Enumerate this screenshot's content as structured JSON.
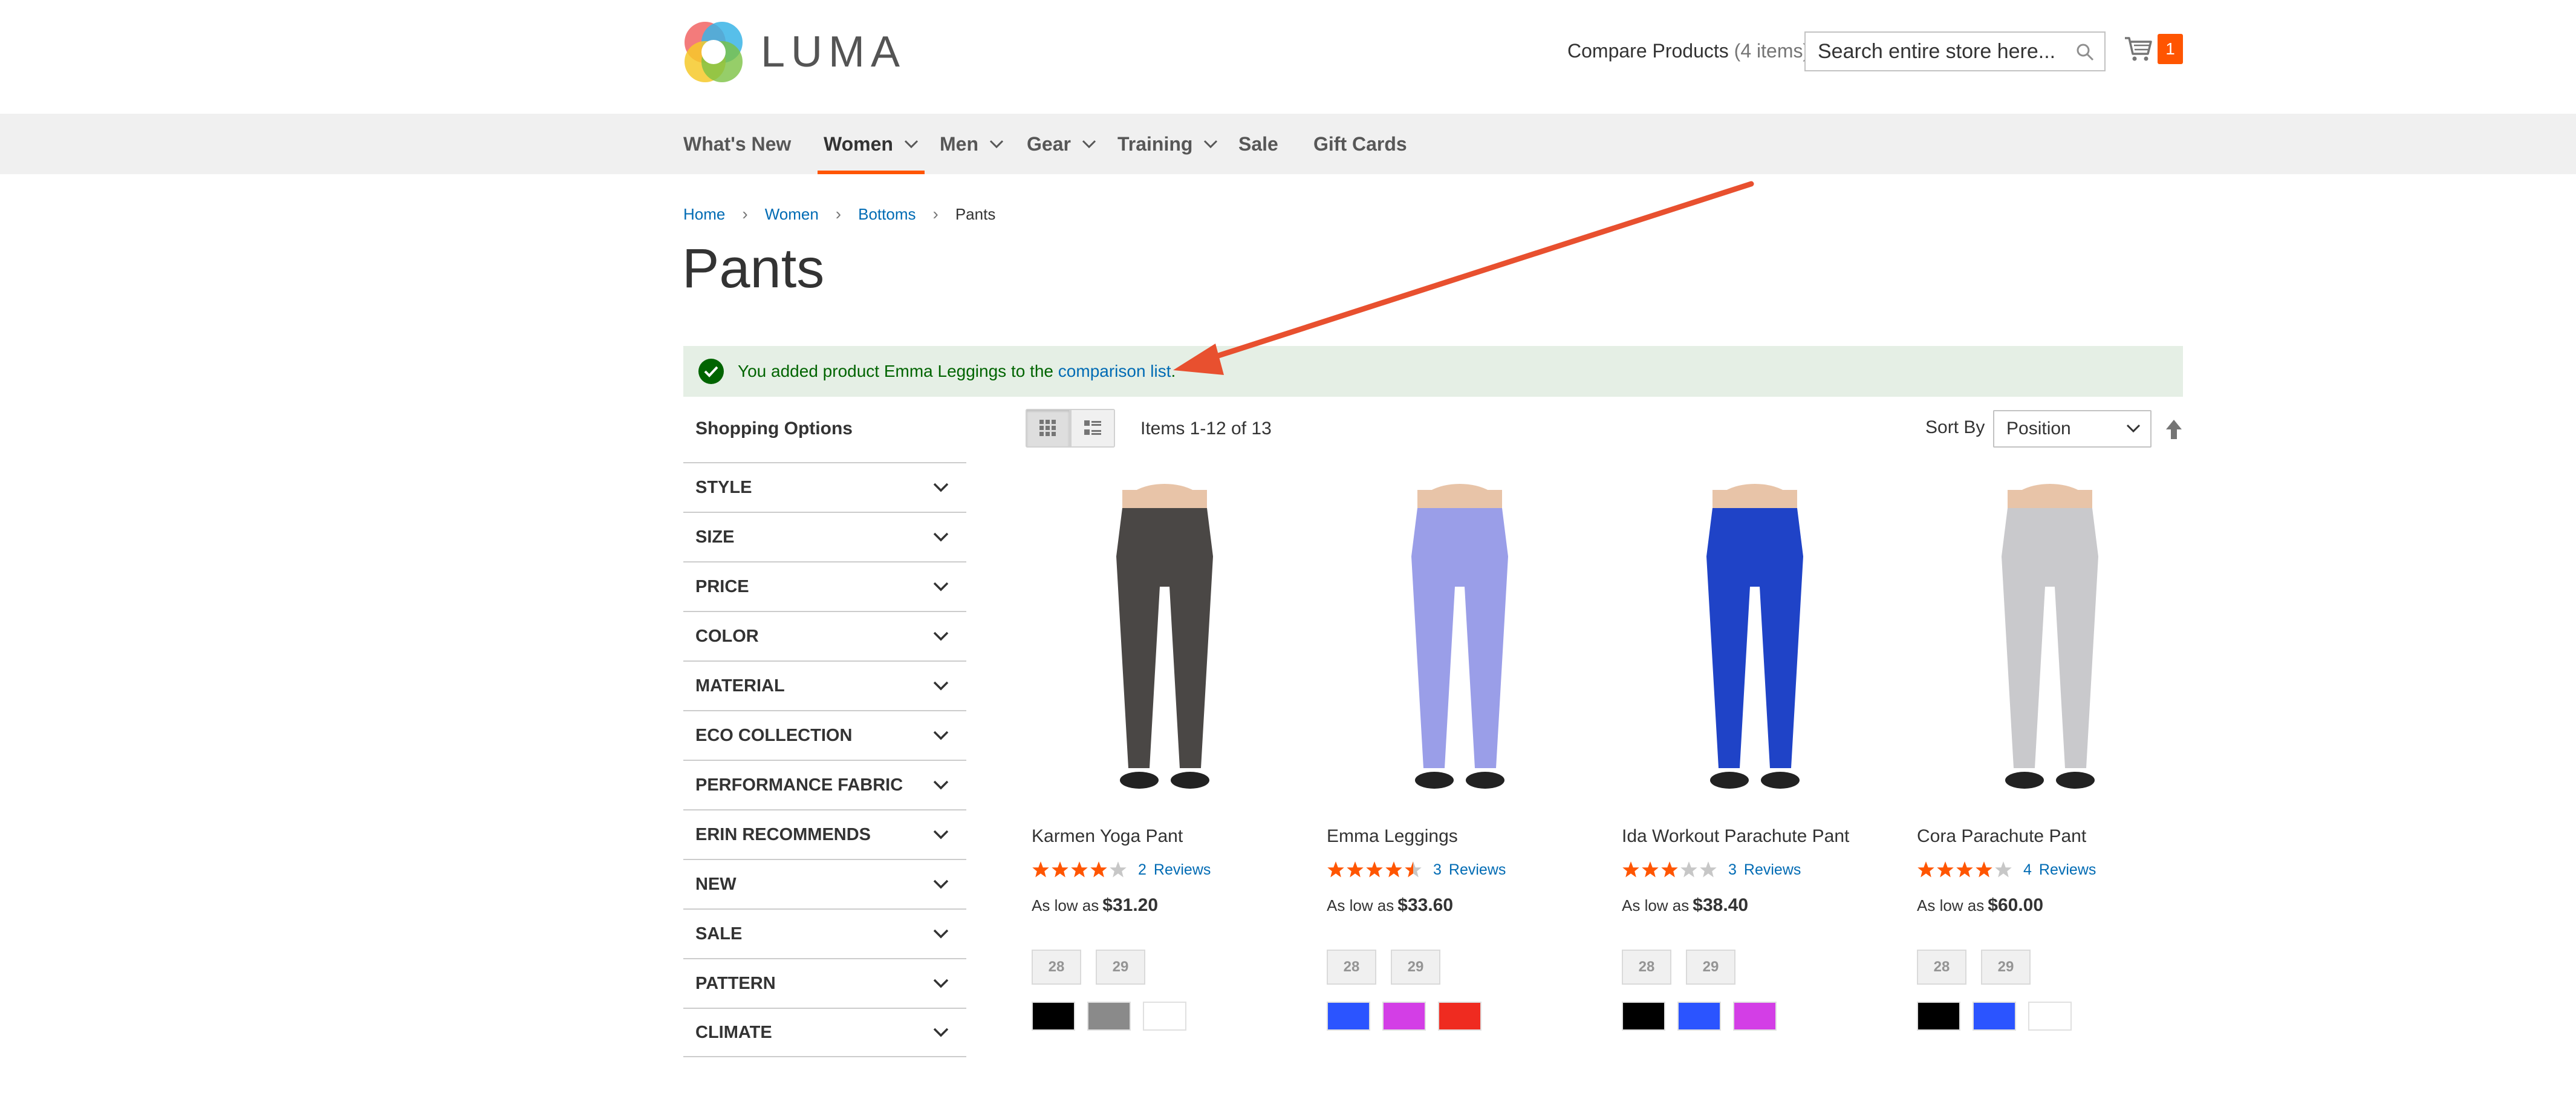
{
  "header": {
    "logo_text": "LUMA",
    "compare": {
      "label": "Compare Products",
      "count": "(4 items)"
    },
    "search": {
      "placeholder": "Search entire store here..."
    },
    "cart_count": "1"
  },
  "nav": [
    {
      "label": "What's New",
      "has_dropdown": false
    },
    {
      "label": "Women",
      "has_dropdown": true,
      "active": true
    },
    {
      "label": "Men",
      "has_dropdown": true
    },
    {
      "label": "Gear",
      "has_dropdown": true
    },
    {
      "label": "Training",
      "has_dropdown": true
    },
    {
      "label": "Sale",
      "has_dropdown": false
    },
    {
      "label": "Gift Cards",
      "has_dropdown": false
    }
  ],
  "breadcrumb": {
    "home": "Home",
    "women": "Women",
    "bottoms": "Bottoms",
    "current": "Pants"
  },
  "page_title": "Pants",
  "message": {
    "text_before": "You added product Emma Leggings to the ",
    "link": "comparison list",
    "text_after": "."
  },
  "sidebar": {
    "title": "Shopping Options",
    "filters": [
      "STYLE",
      "SIZE",
      "PRICE",
      "COLOR",
      "MATERIAL",
      "ECO COLLECTION",
      "PERFORMANCE FABRIC",
      "ERIN RECOMMENDS",
      "NEW",
      "SALE",
      "PATTERN",
      "CLIMATE"
    ]
  },
  "toolbar": {
    "items_count": "Items 1-12 of 13",
    "sort_label": "Sort By",
    "sort_value": "Position",
    "view_mode": "grid"
  },
  "products": [
    {
      "name": "Karmen Yoga Pant",
      "rating": 4,
      "review_count": "2",
      "review_label": "Reviews",
      "price_prefix": "As low as",
      "price": "$31.20",
      "sizes": [
        "28",
        "29"
      ],
      "swatches": [
        "#000000",
        "#8a8a8a",
        "#ffffff"
      ],
      "pant_color": "#4a4745"
    },
    {
      "name": "Emma Leggings",
      "rating": 4.5,
      "review_count": "3",
      "review_label": "Reviews",
      "price_prefix": "As low as",
      "price": "$33.60",
      "sizes": [
        "28",
        "29"
      ],
      "swatches": [
        "#2b54ff",
        "#d33ee6",
        "#ef2b20"
      ],
      "pant_color": "#9a9ee8"
    },
    {
      "name": "Ida Workout Parachute Pant",
      "rating": 3,
      "review_count": "3",
      "review_label": "Reviews",
      "price_prefix": "As low as",
      "price": "$38.40",
      "sizes": [
        "28",
        "29"
      ],
      "swatches": [
        "#000000",
        "#2b54ff",
        "#d33ee6"
      ],
      "pant_color": "#1f43c7"
    },
    {
      "name": "Cora Parachute Pant",
      "rating": 4,
      "review_count": "4",
      "review_label": "Reviews",
      "price_prefix": "As low as",
      "price": "$60.00",
      "sizes": [
        "28",
        "29"
      ],
      "swatches": [
        "#000000",
        "#2b54ff",
        "#ffffff"
      ],
      "pant_color": "#c9c9cc"
    }
  ],
  "colors": {
    "accent": "#ff5501",
    "link": "#006bb4",
    "success_bg": "#e5efe5",
    "success_text": "#006400",
    "nav_bg": "#f0f0f0",
    "star": "#ff5501"
  }
}
